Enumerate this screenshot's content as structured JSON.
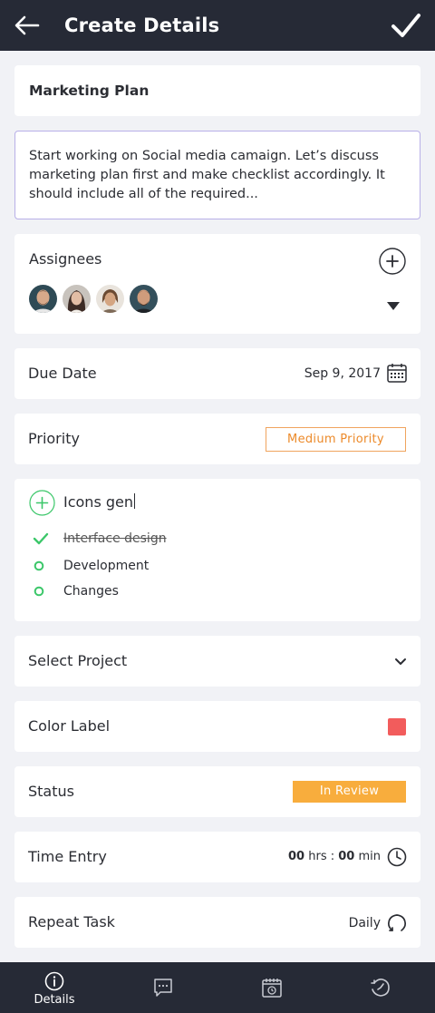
{
  "header": {
    "title": "Create Details",
    "back_icon": "arrow-left-icon",
    "confirm_icon": "checkmark-icon"
  },
  "task": {
    "title": "Marketing Plan",
    "description": "Start working on Social media camaign. Let’s discuss marketing plan first and make checklist accordingly. It should include all of the required..."
  },
  "assignees": {
    "label": "Assignees",
    "add_icon": "plus-circle-icon",
    "dropdown_icon": "caret-down-icon",
    "avatars": [
      "avatar-1",
      "avatar-2",
      "avatar-3",
      "avatar-4"
    ]
  },
  "due_date": {
    "label": "Due Date",
    "value": "Sep 9, 2017",
    "icon": "calendar-icon"
  },
  "priority": {
    "label": "Priority",
    "value": "Medium Priority",
    "color": "#ec8a2a"
  },
  "checklist": {
    "input_value": "Icons gen",
    "add_icon": "plus-circle-icon",
    "items": [
      {
        "label": "Interface design",
        "done": true
      },
      {
        "label": "Development",
        "done": false
      },
      {
        "label": "Changes",
        "done": false
      }
    ],
    "accent": "#3cc76a"
  },
  "project": {
    "label": "Select Project",
    "icon": "chevron-down-icon"
  },
  "color_label": {
    "label": "Color Label",
    "color": "#f25c5c"
  },
  "status": {
    "label": "Status",
    "value": "In Review",
    "color": "#f8ad3d"
  },
  "time_entry": {
    "label": "Time Entry",
    "hours": "00",
    "hours_unit": "hrs :",
    "minutes": "00",
    "minutes_unit": "min",
    "icon": "clock-icon"
  },
  "repeat": {
    "label": "Repeat Task",
    "value": "Daily",
    "icon": "repeat-icon"
  },
  "tabs": [
    {
      "label": "Details",
      "icon": "info-icon",
      "active": true
    },
    {
      "label": "",
      "icon": "chat-icon",
      "active": false
    },
    {
      "label": "",
      "icon": "calendar-clock-icon",
      "active": false
    },
    {
      "label": "",
      "icon": "history-icon",
      "active": false
    }
  ]
}
